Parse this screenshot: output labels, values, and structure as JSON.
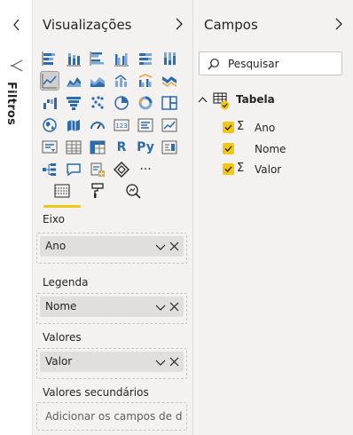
{
  "filters": {
    "label": "Filtros"
  },
  "visualizations": {
    "title": "Visualizações",
    "gallery_text_icons": {
      "r_visual": "R",
      "python_visual": "Py",
      "more": "···"
    },
    "wells": [
      {
        "label": "Eixo",
        "field": "Ano",
        "placeholder": ""
      },
      {
        "label": "Legenda",
        "field": "Nome",
        "placeholder": ""
      },
      {
        "label": "Valores",
        "field": "Valor",
        "placeholder": ""
      },
      {
        "label": "Valores secundários",
        "field": "",
        "placeholder": "Adicionar os campos de da..."
      }
    ]
  },
  "fields": {
    "title": "Campos",
    "search_placeholder": "Pesquisar",
    "table": {
      "name": "Tabela",
      "columns": [
        {
          "name": "Ano",
          "aggregate_symbol": "Σ",
          "checked": true
        },
        {
          "name": "Nome",
          "aggregate_symbol": "",
          "checked": true
        },
        {
          "name": "Valor",
          "aggregate_symbol": "Σ",
          "checked": true
        }
      ]
    }
  },
  "colors": {
    "accent_yellow": "#f2c811",
    "pane_background": "#f3f2f1",
    "icon_blue": "#2b6cb0",
    "icon_orange": "#e8a33d"
  }
}
